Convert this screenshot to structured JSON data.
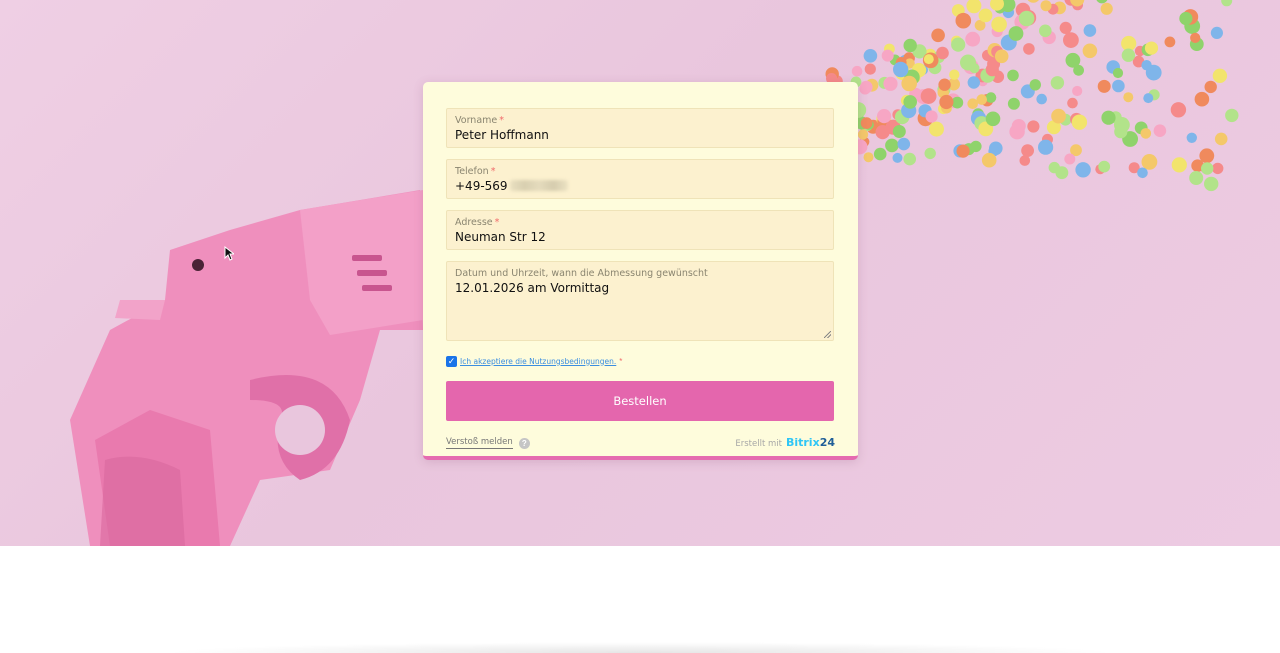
{
  "form": {
    "fields": [
      {
        "label": "Vorname",
        "required_mark": "*",
        "value": "Peter Hoffmann"
      },
      {
        "label": "Telefon",
        "required_mark": "*",
        "value": "+49-569"
      },
      {
        "label": "Adresse",
        "required_mark": "*",
        "value": "Neuman Str 12"
      },
      {
        "label": "Datum und Uhrzeit, wann die Abmessung gewünscht",
        "value": "12.01.2026 am Vormittag"
      }
    ],
    "consent": {
      "checked": true,
      "label": "Ich akzeptiere die Nutzungsbedingungen.",
      "required_mark": "*"
    },
    "submit_label": "Bestellen",
    "footer": {
      "report_label": "Verstoß melden",
      "help_glyph": "?",
      "made_with": "Erstellt mit",
      "brand_text": "Bitrix",
      "brand_number": "24"
    }
  },
  "colors": {
    "accent": "#e466ad",
    "card_background": "#fefcdc",
    "field_background": "#fcf1cf",
    "brand_blue": "#2fc6f6",
    "brand_dark": "#215f98"
  },
  "icons": {
    "checkbox": "checkmark-icon",
    "help": "question-mark-icon",
    "resize": "resize-handle-icon",
    "cursor": "mouse-pointer-icon"
  }
}
